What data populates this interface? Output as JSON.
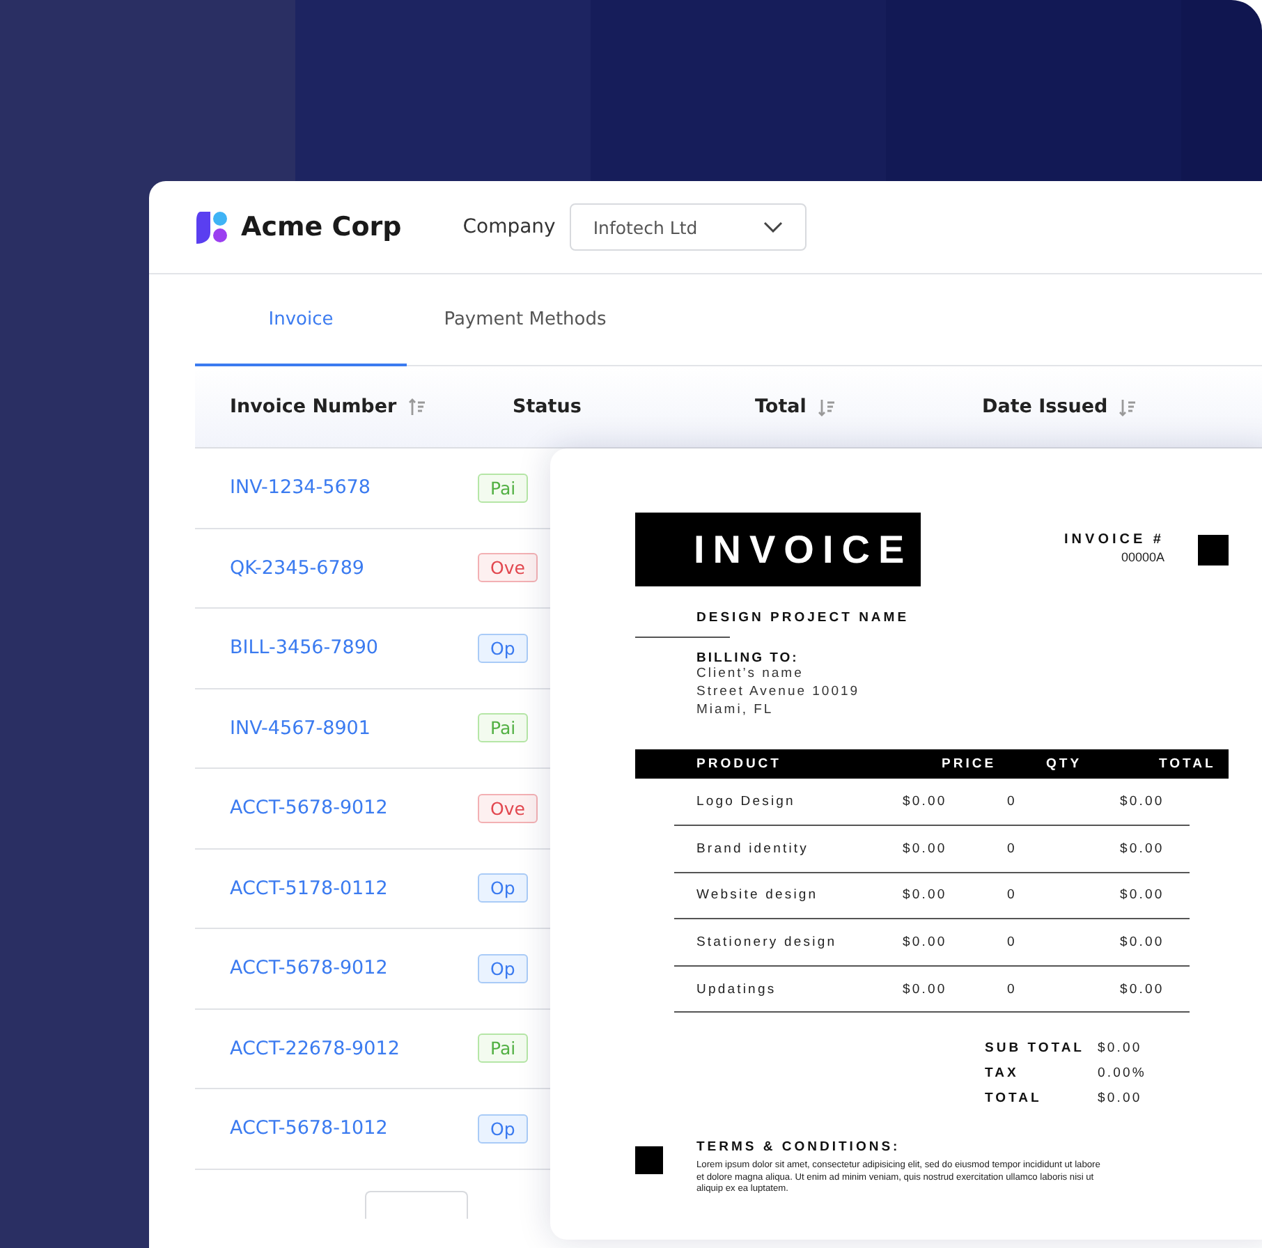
{
  "header": {
    "brand": "Acme Corp",
    "company_label": "Company",
    "company_select": {
      "value": "Infotech Ltd"
    }
  },
  "tabs": [
    {
      "label": "Invoice",
      "selected": true
    },
    {
      "label": "Payment Methods",
      "selected": false
    }
  ],
  "table": {
    "columns": [
      {
        "label": "Invoice Number",
        "sortable": true,
        "ascending": true
      },
      {
        "label": "Status",
        "sortable": false
      },
      {
        "label": "Total",
        "sortable": true,
        "ascending": false
      },
      {
        "label": "Date Issued",
        "sortable": true,
        "ascending": false
      }
    ],
    "rows": [
      {
        "invoice_number": "INV-1234-5678",
        "status": {
          "kind": "paid",
          "text": "Pai"
        }
      },
      {
        "invoice_number": "QK-2345-6789",
        "status": {
          "kind": "overdue",
          "text": "Ove"
        }
      },
      {
        "invoice_number": "BILL-3456-7890",
        "status": {
          "kind": "open",
          "text": "Op"
        }
      },
      {
        "invoice_number": "INV-4567-8901",
        "status": {
          "kind": "paid",
          "text": "Pai"
        }
      },
      {
        "invoice_number": "ACCT-5678-9012",
        "status": {
          "kind": "overdue",
          "text": "Ove"
        }
      },
      {
        "invoice_number": "ACCT-5178-0112",
        "status": {
          "kind": "open",
          "text": "Op"
        }
      },
      {
        "invoice_number": "ACCT-5678-9012",
        "status": {
          "kind": "open",
          "text": "Op"
        }
      },
      {
        "invoice_number": "ACCT-22678-9012",
        "status": {
          "kind": "paid",
          "text": "Pai"
        }
      },
      {
        "invoice_number": "ACCT-5678-1012",
        "status": {
          "kind": "open",
          "text": "Op"
        }
      }
    ]
  },
  "invoice_document": {
    "title": "INVOICE",
    "number_label": "INVOICE #",
    "number": "00000A",
    "project": "DESIGN PROJECT NAME",
    "billing_label": "BILLING TO:",
    "billing_lines": [
      "Client’s name",
      "Street Avenue 10019",
      "Miami, FL"
    ],
    "columns": [
      "PRODUCT",
      "PRICE",
      "QTY",
      "TOTAL"
    ],
    "items": [
      {
        "product": "Logo Design",
        "price": "$0.00",
        "qty": "0",
        "total": "$0.00"
      },
      {
        "product": "Brand identity",
        "price": "$0.00",
        "qty": "0",
        "total": "$0.00"
      },
      {
        "product": "Website design",
        "price": "$0.00",
        "qty": "0",
        "total": "$0.00"
      },
      {
        "product": "Stationery design",
        "price": "$0.00",
        "qty": "0",
        "total": "$0.00"
      },
      {
        "product": "Updatings",
        "price": "$0.00",
        "qty": "0",
        "total": "$0.00"
      }
    ],
    "summary": [
      {
        "label": "SUB TOTAL",
        "value": "$0.00"
      },
      {
        "label": "TAX",
        "value": "0.00%"
      },
      {
        "label": "TOTAL",
        "value": "$0.00"
      }
    ],
    "terms_label": "TERMS & CONDITIONS:",
    "terms_text": "Lorem ipsum dolor sit amet, consectetur adipisicing elit, sed do eiusmod tempor incididunt ut labore  et dolore magna aliqua. Ut enim ad minim veniam, quis nostrud exercitation ullamco laboris nisi ut  aliquip ex ea luptatem."
  }
}
